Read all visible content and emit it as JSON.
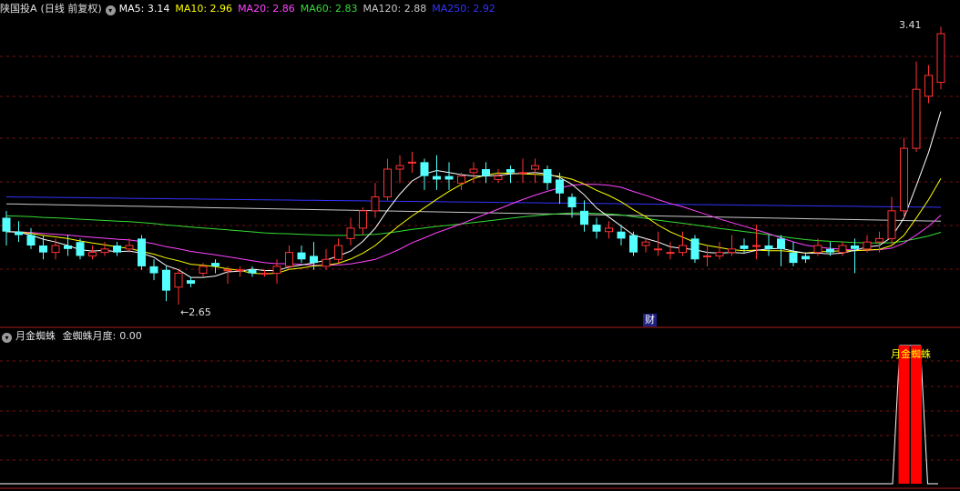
{
  "main_header": {
    "title": "陕国投A",
    "mode": "(日线 前复权)",
    "ma_items": [
      {
        "label": "MA5:",
        "value": "3.14",
        "color": "#ffffff"
      },
      {
        "label": "MA10:",
        "value": "2.96",
        "color": "#ffff00"
      },
      {
        "label": "MA20:",
        "value": "2.86",
        "color": "#ff44ff"
      },
      {
        "label": "MA60:",
        "value": "2.83",
        "color": "#33dd33"
      },
      {
        "label": "MA120:",
        "value": "2.88",
        "color": "#c8c8c8"
      },
      {
        "label": "MA250:",
        "value": "2.92",
        "color": "#3333ff"
      }
    ]
  },
  "annotations": {
    "high": "3.41",
    "low": "2.65",
    "badge": "财"
  },
  "sub_header": {
    "title": "月金蜘蛛",
    "indicator_label": "金蜘蛛月度:",
    "indicator_value": "0.00",
    "signal_label": "月金蜘蛛"
  },
  "colors": {
    "up": "#ff3232",
    "down": "#54ffff",
    "grid": "#7a1010",
    "border": "#aa2020",
    "signal": "#ff0000",
    "signal_text": "#ffff00"
  },
  "chart_data": [
    {
      "type": "candlestick",
      "title": "",
      "ylim": [
        2.6,
        3.48
      ],
      "grid": true,
      "candles": [
        [
          2.9,
          2.86,
          2.92,
          2.82
        ],
        [
          2.86,
          2.85,
          2.89,
          2.83
        ],
        [
          2.85,
          2.82,
          2.87,
          2.81
        ],
        [
          2.82,
          2.8,
          2.85,
          2.78
        ],
        [
          2.8,
          2.82,
          2.84,
          2.78
        ],
        [
          2.82,
          2.81,
          2.85,
          2.79
        ],
        [
          2.83,
          2.79,
          2.84,
          2.78
        ],
        [
          2.79,
          2.8,
          2.82,
          2.78
        ],
        [
          2.8,
          2.81,
          2.83,
          2.79
        ],
        [
          2.82,
          2.8,
          2.83,
          2.79
        ],
        [
          2.81,
          2.82,
          2.84,
          2.8
        ],
        [
          2.84,
          2.76,
          2.85,
          2.75
        ],
        [
          2.76,
          2.74,
          2.78,
          2.72
        ],
        [
          2.75,
          2.69,
          2.76,
          2.66
        ],
        [
          2.7,
          2.74,
          2.75,
          2.65
        ],
        [
          2.72,
          2.71,
          2.73,
          2.7
        ],
        [
          2.74,
          2.76,
          2.77,
          2.73
        ],
        [
          2.77,
          2.76,
          2.78,
          2.74
        ],
        [
          2.75,
          2.75,
          2.76,
          2.71
        ],
        [
          2.75,
          2.75,
          2.76,
          2.73
        ],
        [
          2.75,
          2.74,
          2.76,
          2.73
        ],
        [
          2.74,
          2.74,
          2.75,
          2.73
        ],
        [
          2.74,
          2.76,
          2.78,
          2.71
        ],
        [
          2.76,
          2.8,
          2.82,
          2.75
        ],
        [
          2.8,
          2.78,
          2.82,
          2.77
        ],
        [
          2.79,
          2.77,
          2.83,
          2.75
        ],
        [
          2.76,
          2.78,
          2.81,
          2.75
        ],
        [
          2.78,
          2.82,
          2.84,
          2.77
        ],
        [
          2.84,
          2.87,
          2.9,
          2.82
        ],
        [
          2.87,
          2.92,
          2.93,
          2.85
        ],
        [
          2.92,
          2.96,
          3.0,
          2.9
        ],
        [
          2.96,
          3.04,
          3.07,
          2.95
        ],
        [
          3.04,
          3.05,
          3.08,
          3.0
        ],
        [
          3.06,
          3.06,
          3.09,
          3.03
        ],
        [
          3.06,
          3.02,
          3.07,
          2.98
        ],
        [
          3.02,
          3.01,
          3.08,
          2.98
        ],
        [
          3.02,
          3.01,
          3.06,
          2.98
        ],
        [
          3.0,
          3.02,
          3.03,
          2.98
        ],
        [
          3.03,
          3.04,
          3.06,
          3.0
        ],
        [
          3.04,
          3.02,
          3.06,
          3.0
        ],
        [
          3.01,
          3.02,
          3.04,
          3.0
        ],
        [
          3.04,
          3.03,
          3.05,
          3.0
        ],
        [
          3.03,
          3.03,
          3.07,
          3.0
        ],
        [
          3.04,
          3.05,
          3.07,
          3.0
        ],
        [
          3.04,
          3.0,
          3.05,
          2.98
        ],
        [
          3.01,
          2.97,
          3.03,
          2.94
        ],
        [
          2.96,
          2.93,
          2.97,
          2.9
        ],
        [
          2.92,
          2.88,
          2.95,
          2.86
        ],
        [
          2.88,
          2.86,
          2.9,
          2.84
        ],
        [
          2.86,
          2.87,
          2.89,
          2.84
        ],
        [
          2.86,
          2.84,
          2.88,
          2.82
        ],
        [
          2.85,
          2.8,
          2.86,
          2.79
        ],
        [
          2.82,
          2.83,
          2.84,
          2.8
        ],
        [
          2.81,
          2.81,
          2.86,
          2.79
        ],
        [
          2.8,
          2.8,
          2.83,
          2.78
        ],
        [
          2.8,
          2.82,
          2.86,
          2.79
        ],
        [
          2.84,
          2.78,
          2.85,
          2.77
        ],
        [
          2.79,
          2.79,
          2.82,
          2.76
        ],
        [
          2.79,
          2.8,
          2.83,
          2.78
        ],
        [
          2.8,
          2.81,
          2.85,
          2.79
        ],
        [
          2.82,
          2.81,
          2.84,
          2.8
        ],
        [
          2.82,
          2.82,
          2.88,
          2.78
        ],
        [
          2.82,
          2.81,
          2.85,
          2.79
        ],
        [
          2.84,
          2.81,
          2.85,
          2.76
        ],
        [
          2.8,
          2.77,
          2.83,
          2.76
        ],
        [
          2.79,
          2.78,
          2.8,
          2.77
        ],
        [
          2.8,
          2.82,
          2.84,
          2.79
        ],
        [
          2.81,
          2.8,
          2.83,
          2.79
        ],
        [
          2.8,
          2.82,
          2.83,
          2.79
        ],
        [
          2.82,
          2.81,
          2.84,
          2.74
        ],
        [
          2.81,
          2.83,
          2.85,
          2.8
        ],
        [
          2.83,
          2.84,
          2.86,
          2.8
        ],
        [
          2.84,
          2.92,
          2.96,
          2.82
        ],
        [
          2.92,
          3.1,
          3.13,
          2.9
        ],
        [
          3.1,
          3.27,
          3.35,
          3.09
        ],
        [
          3.25,
          3.31,
          3.34,
          3.23
        ],
        [
          3.29,
          3.43,
          3.45,
          3.27
        ]
      ]
    },
    {
      "type": "bar",
      "title": "月金蜘蛛",
      "ylim": [
        0,
        1
      ],
      "signal_indices": [
        73,
        74
      ]
    }
  ]
}
